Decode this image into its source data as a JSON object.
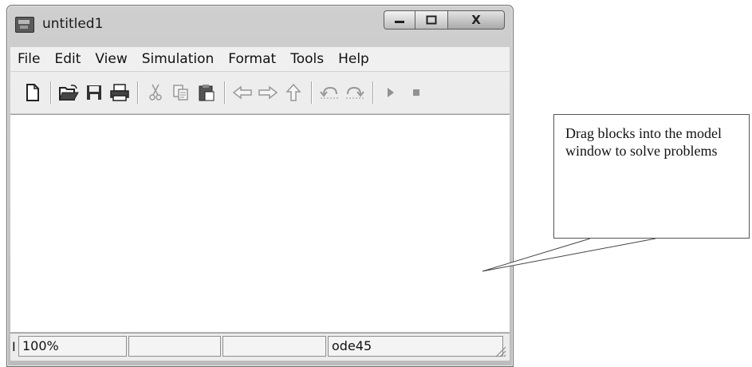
{
  "window": {
    "title": "untitled1"
  },
  "caption_buttons": {
    "minimize": "–",
    "maximize": "□",
    "close": "X"
  },
  "menu": {
    "items": [
      "File",
      "Edit",
      "View",
      "Simulation",
      "Format",
      "Tools",
      "Help"
    ]
  },
  "toolbar": {
    "icons": [
      "new-model-icon",
      "open-icon",
      "save-icon",
      "print-icon",
      "cut-icon",
      "copy-icon",
      "paste-icon",
      "back-icon",
      "forward-icon",
      "up-icon",
      "undo-icon",
      "redo-icon",
      "start-simulation-icon",
      "stop-simulation-icon"
    ]
  },
  "status": {
    "cell_prefix": "I",
    "zoom": "100%",
    "empty1": "",
    "empty2": "",
    "solver": "ode45"
  },
  "callout": {
    "text": "Drag blocks into the model window to solve problems"
  }
}
